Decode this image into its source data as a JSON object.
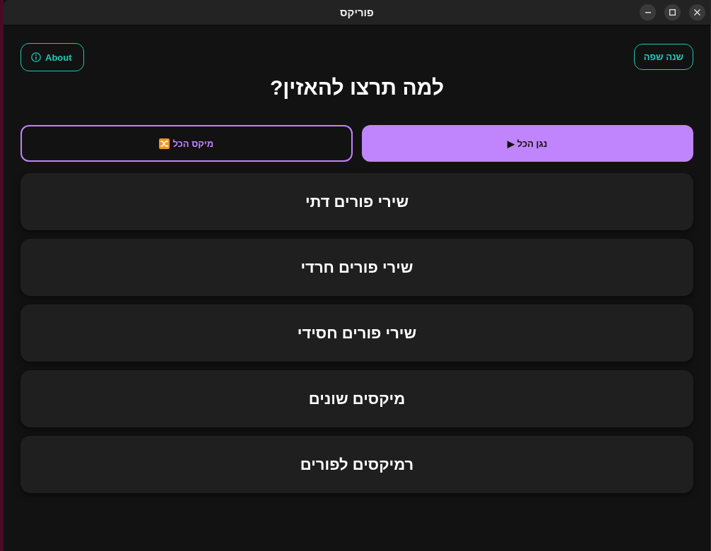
{
  "window": {
    "title": "פוריקס"
  },
  "header": {
    "language_button": "שנה שפה",
    "about_button": "About",
    "heading": "למה תרצו להאזין?"
  },
  "actions": [
    {
      "kind": "play",
      "label": "נגן הכל ▶"
    },
    {
      "kind": "shuffle",
      "label": "מיקס הכל"
    }
  ],
  "categories": [
    "שירי פורים דתי",
    "שירי פורים חרדי",
    "שירי פורים חסידי",
    "מיקסים שונים",
    "רמיקסים לפורים"
  ]
}
